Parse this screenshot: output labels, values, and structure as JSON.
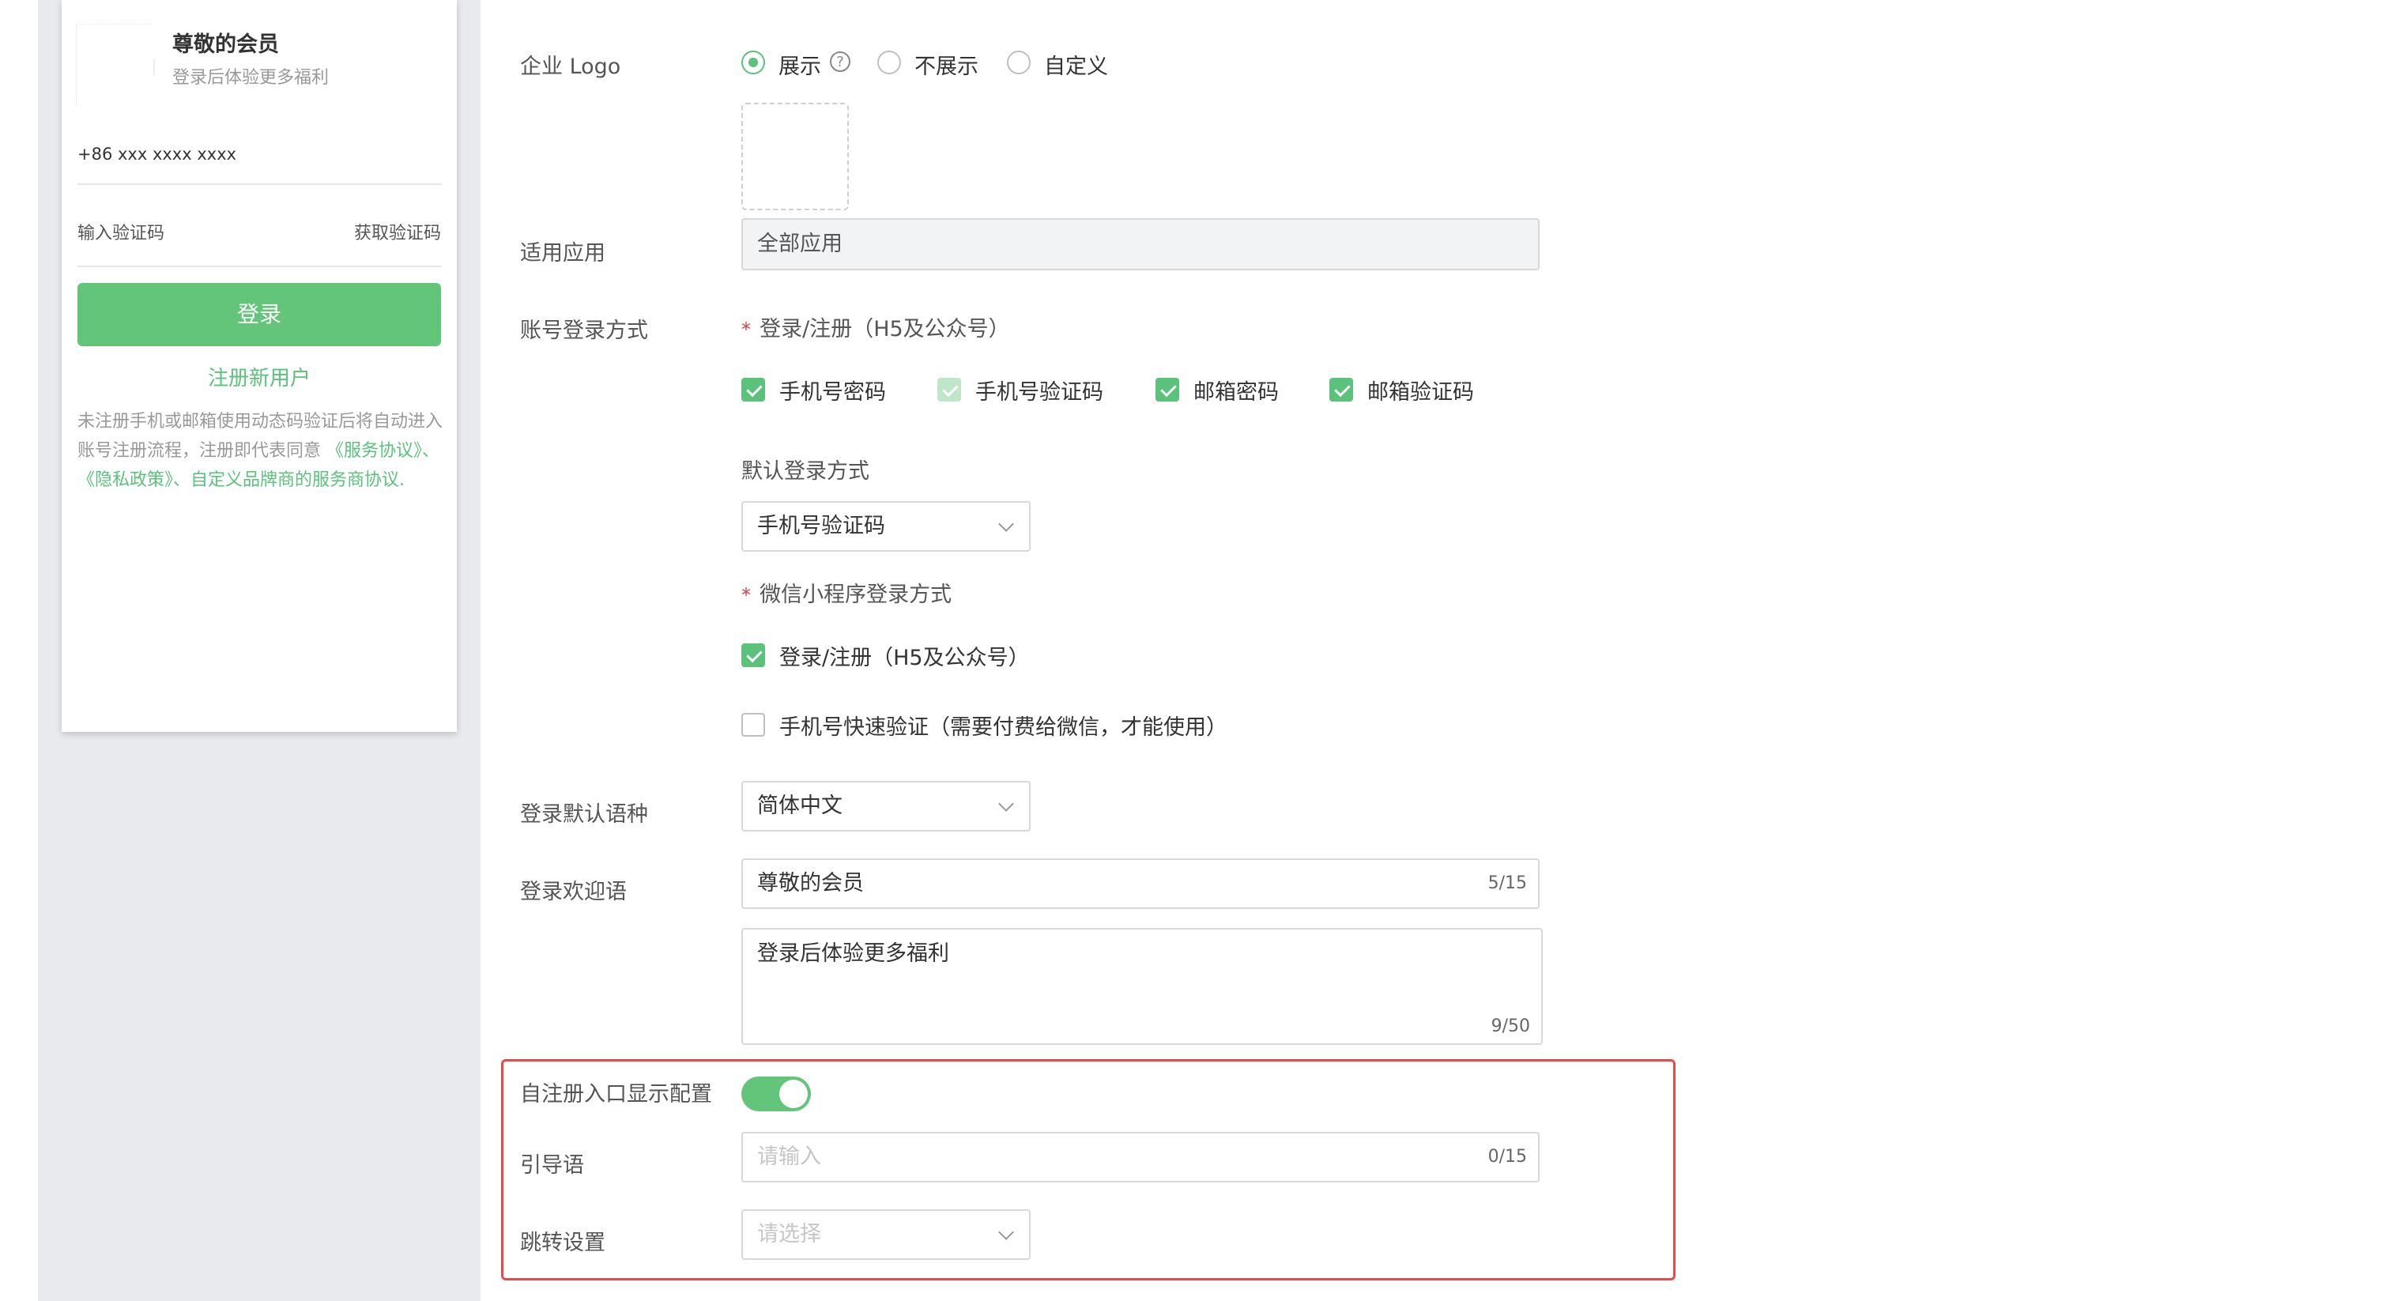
{
  "preview": {
    "title": "尊敬的会员",
    "subtitle": "登录后体验更多福利",
    "phone_placeholder": "+86 xxx xxxx xxxx",
    "code_placeholder": "输入验证码",
    "get_code": "获取验证码",
    "login_button": "登录",
    "register_link": "注册新用户",
    "notice_text": "未注册手机或邮箱使用动态码验证后将自动进入账号注册流程，注册即代表同意",
    "notice_link": "《服务协议》、《隐私政策》、自定义品牌商的服务商协议."
  },
  "form": {
    "logo": {
      "label": "企业 Logo",
      "options": [
        "展示",
        "不展示",
        "自定义"
      ],
      "selected": "展示"
    },
    "apps": {
      "label": "适用应用",
      "value": "全部应用"
    },
    "login_methods": {
      "label": "账号登录方式",
      "section_title": "登录/注册（H5及公众号）",
      "options": [
        "手机号密码",
        "手机号验证码",
        "邮箱密码",
        "邮箱验证码"
      ],
      "default_label": "默认登录方式",
      "default_value": "手机号验证码",
      "wechat_title": "微信小程序登录方式",
      "wechat_options": [
        "登录/注册（H5及公众号）",
        "手机号快速验证（需要付费给微信，才能使用）"
      ]
    },
    "language": {
      "label": "登录默认语种",
      "value": "简体中文"
    },
    "welcome": {
      "label": "登录欢迎语",
      "title_value": "尊敬的会员",
      "title_count": "5/15",
      "desc_value": "登录后体验更多福利",
      "desc_count": "9/50"
    },
    "self_register": {
      "label": "自注册入口显示配置",
      "enabled": true,
      "guide_label": "引导语",
      "guide_placeholder": "请输入",
      "guide_count": "0/15",
      "jump_label": "跳转设置",
      "jump_placeholder": "请选择"
    }
  },
  "colors": {
    "accent": "#5bc27b",
    "button": "#63c57a",
    "highlight_border": "#e84a4a"
  }
}
